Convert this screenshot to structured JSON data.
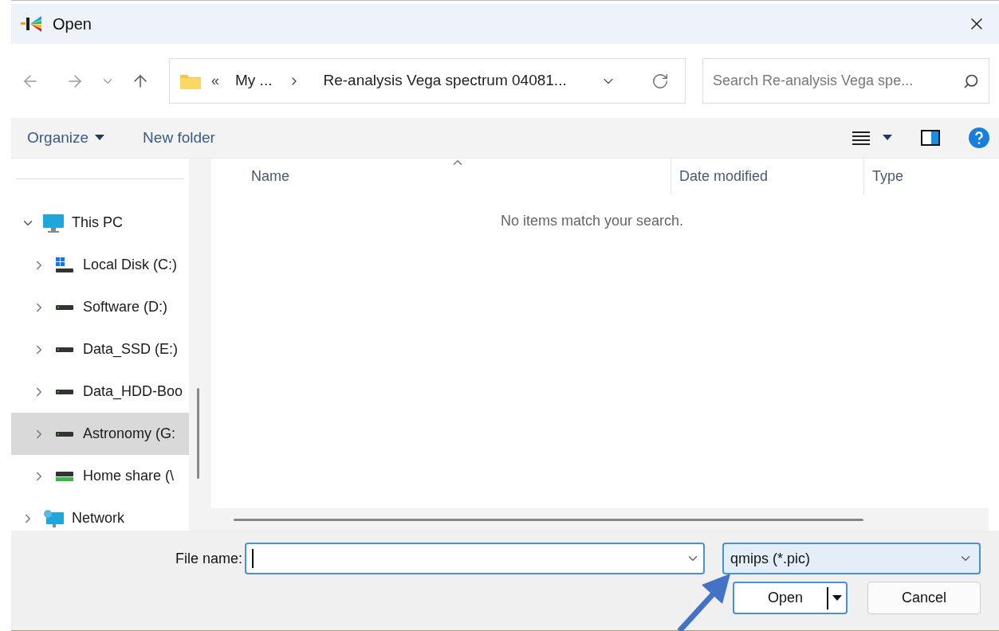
{
  "window": {
    "title": "Open"
  },
  "address": {
    "overflow": "«",
    "crumbs": [
      "My ...",
      "Re-analysis Vega spectrum 04081..."
    ]
  },
  "search": {
    "placeholder": "Search Re-analysis Vega spe..."
  },
  "toolbar": {
    "organize": "Organize",
    "new_folder": "New folder"
  },
  "tree": [
    {
      "label": "This PC",
      "kind": "pc",
      "expanded": true,
      "selected": false,
      "children": [
        {
          "label": "Local Disk (C:)",
          "kind": "system-disk",
          "expanded": false,
          "selected": false
        },
        {
          "label": "Software (D:)",
          "kind": "disk",
          "expanded": false,
          "selected": false
        },
        {
          "label": "Data_SSD (E:)",
          "kind": "disk",
          "expanded": false,
          "selected": false
        },
        {
          "label": "Data_HDD-Boo",
          "kind": "disk",
          "expanded": false,
          "selected": false
        },
        {
          "label": "Astronomy (G:",
          "kind": "disk",
          "expanded": false,
          "selected": true
        },
        {
          "label": "Home share (\\",
          "kind": "network-disk",
          "expanded": false,
          "selected": false
        }
      ]
    },
    {
      "label": "Network",
      "kind": "network",
      "expanded": false,
      "selected": false
    }
  ],
  "table": {
    "columns": [
      "Name",
      "Date modified",
      "Type"
    ],
    "empty_message": "No items match your search."
  },
  "file_name": {
    "label": "File name:"
  },
  "file_type": {
    "value": "qmips (*.pic)"
  },
  "buttons": {
    "open": "Open",
    "cancel": "Cancel"
  }
}
